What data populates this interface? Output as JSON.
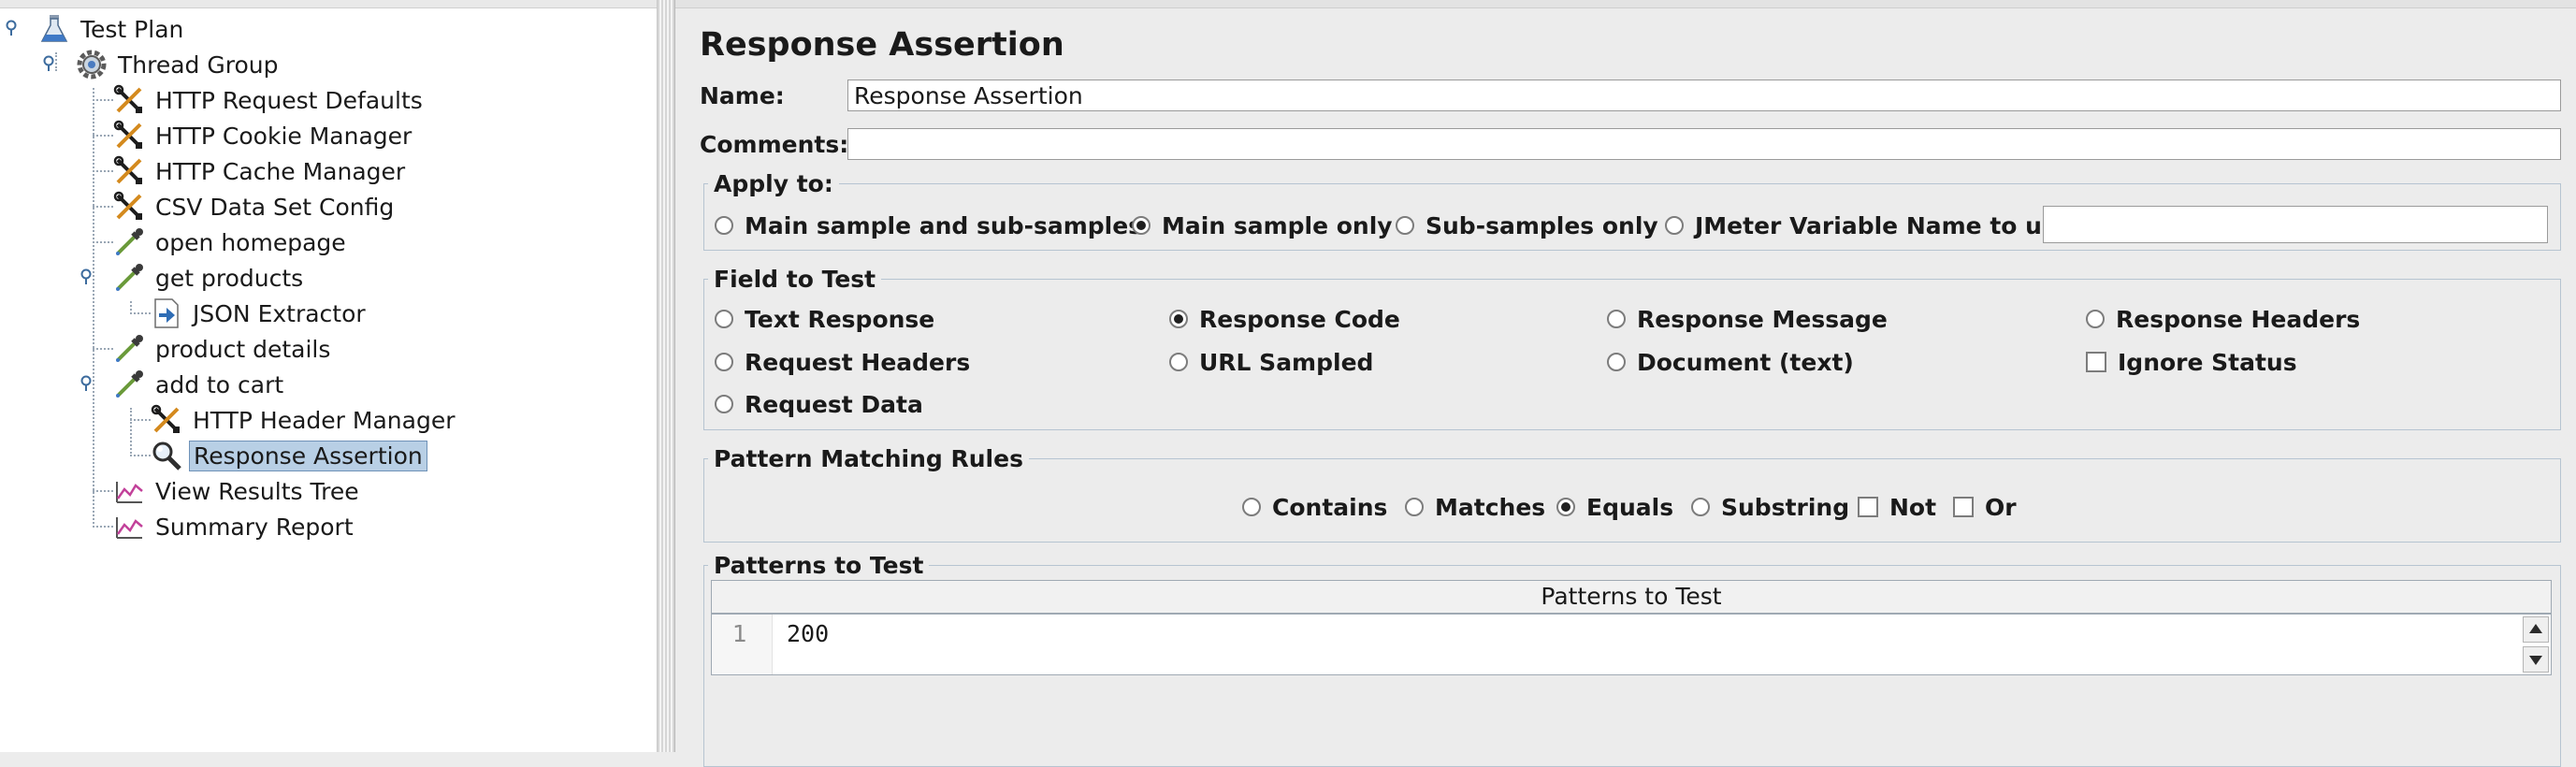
{
  "tree": {
    "items": [
      {
        "label": "Test Plan",
        "icon": "test-plan-flask-icon"
      },
      {
        "label": "Thread Group",
        "icon": "thread-group-gear-icon"
      },
      {
        "label": "HTTP Request Defaults",
        "icon": "config-element-tools-icon"
      },
      {
        "label": "HTTP Cookie Manager",
        "icon": "config-element-tools-icon"
      },
      {
        "label": "HTTP Cache Manager",
        "icon": "config-element-tools-icon"
      },
      {
        "label": "CSV Data Set Config",
        "icon": "config-element-tools-icon"
      },
      {
        "label": "open homepage",
        "icon": "sampler-pipette-icon"
      },
      {
        "label": "get products",
        "icon": "sampler-pipette-icon"
      },
      {
        "label": "JSON Extractor",
        "icon": "post-processor-arrow-icon"
      },
      {
        "label": "product details",
        "icon": "sampler-pipette-icon"
      },
      {
        "label": "add to cart",
        "icon": "sampler-pipette-icon"
      },
      {
        "label": "HTTP Header Manager",
        "icon": "config-element-tools-icon"
      },
      {
        "label": "Response Assertion",
        "icon": "assertion-magnifier-icon"
      },
      {
        "label": "View Results Tree",
        "icon": "listener-graph-icon"
      },
      {
        "label": "Summary Report",
        "icon": "listener-graph-icon"
      }
    ],
    "selected": "Response Assertion"
  },
  "form": {
    "title": "Response Assertion",
    "name_label": "Name:",
    "name_value": "Response Assertion",
    "comments_label": "Comments:",
    "comments_value": "",
    "apply_to": {
      "legend": "Apply to:",
      "options": [
        "Main sample and sub-samples",
        "Main sample only",
        "Sub-samples only",
        "JMeter Variable Name to use"
      ],
      "selected": "Main sample only",
      "variable_value": ""
    },
    "field_to_test": {
      "legend": "Field to Test",
      "options": [
        "Text Response",
        "Response Code",
        "Response Message",
        "Response Headers",
        "Request Headers",
        "URL Sampled",
        "Document (text)",
        "Request Data"
      ],
      "selected": "Response Code",
      "ignore_status_label": "Ignore Status",
      "ignore_status_checked": false
    },
    "pattern_matching": {
      "legend": "Pattern Matching Rules",
      "options": [
        "Contains",
        "Matches",
        "Equals",
        "Substring"
      ],
      "selected": "Equals",
      "not_label": "Not",
      "not_checked": false,
      "or_label": "Or",
      "or_checked": false
    },
    "patterns": {
      "legend": "Patterns to Test",
      "column_header": "Patterns to Test",
      "rows": [
        {
          "line": "1",
          "value": "200"
        }
      ]
    }
  }
}
